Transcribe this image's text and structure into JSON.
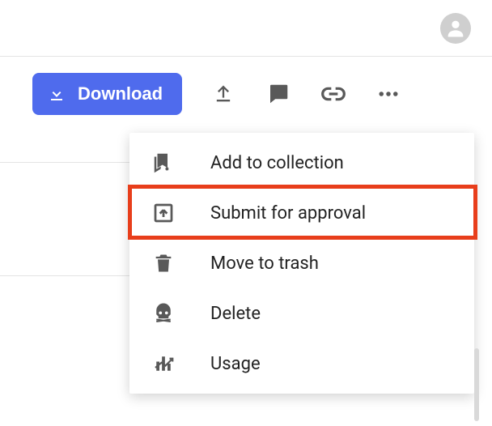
{
  "colors": {
    "accent": "#4f6bed",
    "highlight": "#e83e1b",
    "icon": "#595959"
  },
  "toolbar": {
    "download_label": "Download"
  },
  "menu": {
    "items": [
      {
        "label": "Add to collection"
      },
      {
        "label": "Submit for approval"
      },
      {
        "label": "Move to trash"
      },
      {
        "label": "Delete"
      },
      {
        "label": "Usage"
      }
    ],
    "highlighted_index": 1
  }
}
